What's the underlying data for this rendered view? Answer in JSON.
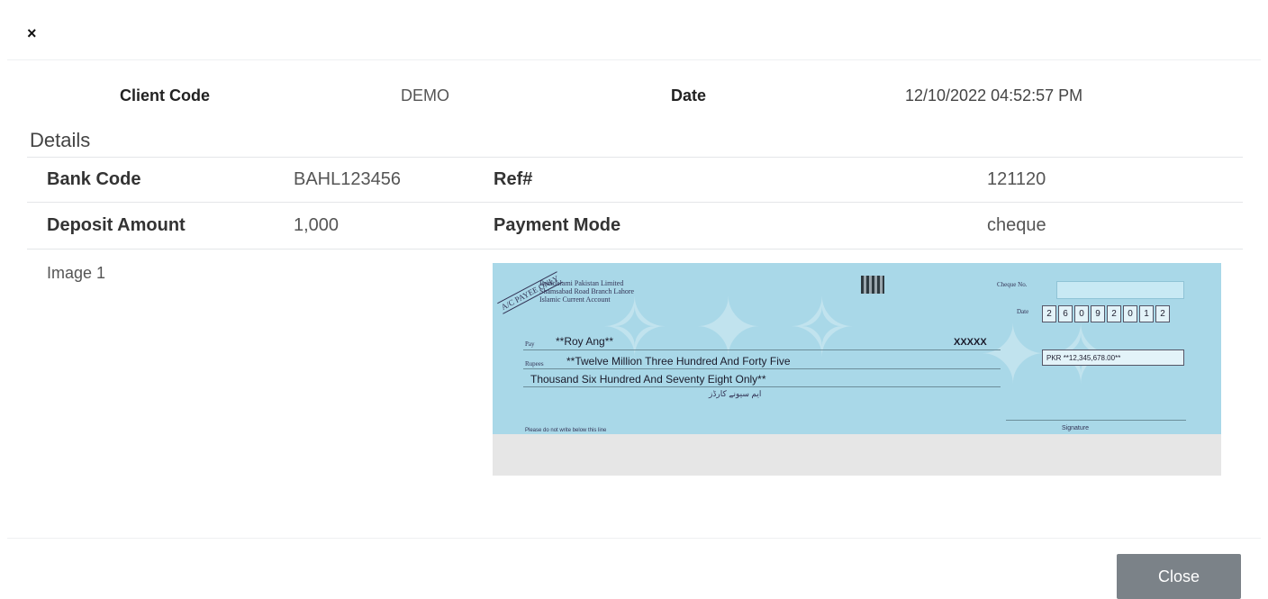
{
  "modal": {
    "close_icon": "×",
    "header": {
      "client_code_label": "Client Code",
      "client_code_value": "DEMO",
      "date_label": "Date",
      "date_value": "12/10/2022 04:52:57 PM"
    },
    "details_title": "Details",
    "rows": [
      {
        "label1": "Bank Code",
        "value1": "BAHL123456",
        "label2": "Ref#",
        "value2": "121120"
      },
      {
        "label1": "Deposit Amount",
        "value1": "1,000",
        "label2": "Payment Mode",
        "value2": "cheque"
      }
    ],
    "image_label": "Image 1",
    "cheque": {
      "bank_lines": [
        "BankIslami Pakistan Limited",
        "Shamsabad Road Branch Lahore",
        "Islamic Current Account"
      ],
      "crossing": "A/C PAYEE ONLY",
      "cheque_no_label": "Cheque No.",
      "date_label": "Date",
      "date_digits": [
        "2",
        "6",
        "0",
        "9",
        "2",
        "0",
        "1",
        "2"
      ],
      "pay_label": "Pay",
      "payee": "**Roy Ang**",
      "bearer_mark": "XXXXX",
      "rupees_label": "Rupees",
      "amount_words_1": "**Twelve Million Three Hundred And Forty Five",
      "amount_words_2": "Thousand Six Hundred And Seventy Eight Only**",
      "urdu_text": "ایم سیونے کارڈز",
      "amount_figures": "**12,345,678.00**",
      "amount_figures_label": "PKR",
      "signature_label": "Signature",
      "footnote": "Please do not write below this line"
    },
    "close_button_label": "Close"
  }
}
